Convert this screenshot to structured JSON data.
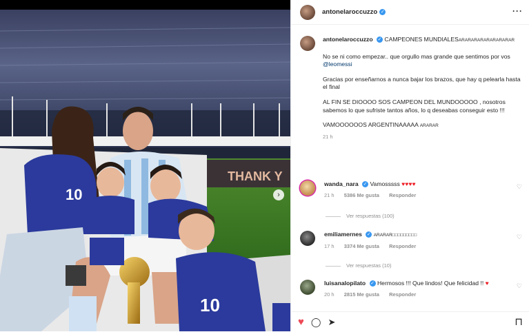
{
  "photo": {
    "banner_text": "THANK Y",
    "shirt_number": "10"
  },
  "post": {
    "username": "antonelaroccuzzo",
    "verified_mark": "✓",
    "more_icon": "···",
    "caption": {
      "title": "CAMPEONES MUNDIALES",
      "title_tail": "ARARARARARARARARAR",
      "line1": "No se ni como empezar.. que orgullo mas grande que sentimos por vos",
      "mention": "@leomessi",
      "line2": "Gracias por enseñarnos a nunca bajar los brazos, que hay q pelearla hasta el final",
      "line3": "AL FIN SE DIOOOO SOS CAMPEON DEL MUNDOOOOO , nosotros sabemos lo que sufriste tantos años, lo q deseabas conseguir esto !!!",
      "line4": "VAMOOOOOOS ARGENTINAAAAA",
      "line4_tail": "ARARAR",
      "time": "21 h"
    }
  },
  "comments": [
    {
      "username": "wanda_nara",
      "text": "Vamosssss",
      "hearts": "♥♥♥♥",
      "time": "21 h",
      "likes": "5386 Me gusta",
      "reply": "Responder",
      "replies": "Ver respuestas (100)"
    },
    {
      "username": "emiliamernes",
      "text": "ARARAR□□□□□□□□□",
      "time": "17 h",
      "likes": "3374 Me gusta",
      "reply": "Responder",
      "replies": "Ver respuestas (10)"
    },
    {
      "username": "luisanalopilato",
      "text": "Hermosos !!! Que lindos! Que felicidad !!",
      "hearts": "♥",
      "time": "20 h",
      "likes": "2815 Me gusta",
      "reply": "Responder"
    }
  ],
  "icons": {
    "heart_outline": "♡",
    "heart_filled": "♥",
    "comment": "◯",
    "share": "➤",
    "save": "⊓",
    "next": "›"
  },
  "colors": {
    "like_red": "#ed4956",
    "verified_blue": "#3897f0",
    "mention_blue": "#00376b"
  }
}
